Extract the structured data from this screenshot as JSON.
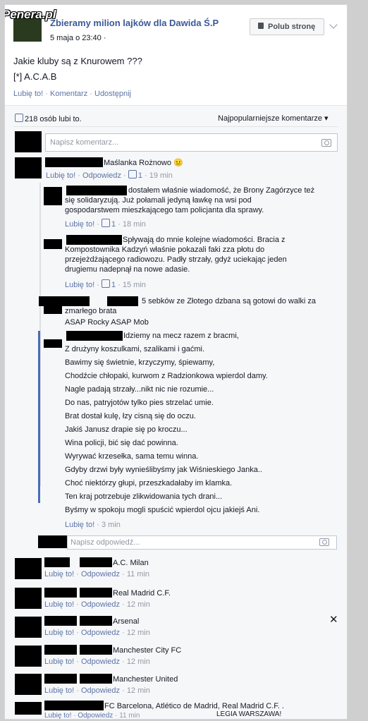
{
  "watermark": "Penera.pl",
  "post": {
    "page_name": "Zbieramy milion lajków dla Dawida Ś.P",
    "timestamp": "5 maja o 23:40 ·",
    "like_page_label": "Polub stronę",
    "body_line1": "Jakie kluby są z Knurowem ???",
    "body_line2": "[*] A.C.A.B",
    "actions": {
      "like": "Lubię to!",
      "comment": "Komentarz",
      "share": "Udostępnij"
    }
  },
  "stats": {
    "likes_text": "218 osób lubi to.",
    "sort_label": "Najpopularniejsze komentarze"
  },
  "comment_input_placeholder": "Napisz komentarz...",
  "reply_input_placeholder": "Napisz odpowiedź...",
  "comments": {
    "c1": {
      "text": "Maślanka Rożnowo 😐",
      "like": "Lubię to!",
      "reply": "Odpowiedz",
      "like_count": "1",
      "time": "19 min"
    },
    "r1": {
      "lines": [
        "dostałem właśnie wiadomość, że Brony Zagórzyce też",
        "się solidaryzują. Już połamali jedyną ławkę na wsi pod",
        "gospodarstwem mieszkającego tam policjanta dla sprawy."
      ],
      "like": "Lubię to!",
      "like_count": "1",
      "time": "18 min"
    },
    "r2": {
      "lines": [
        "Spływają do mnie kolejne wiadomości. Bracia z",
        "Kompostownika Kadzyń właśnie pokazali faki zza płotu do",
        "przejeżdżającego radiowozu. Padły strzały, gdyż uciekając jeden",
        "drugiemu nadepnął na nowe adasie."
      ],
      "like": "Lubię to!",
      "like_count": "1",
      "time": "15 min"
    },
    "r3": {
      "lines": [
        "5 sebków ze Złotego dzbana są gotowi do walki za",
        "zmarłego brata"
      ],
      "link": "ASAP Rocky ASAP Mob"
    },
    "r4": {
      "lines": [
        "Idziemy na mecz razem z bracmi,",
        "Z drużyny koszulkami, szalikami i gaćmi.",
        "Bawimy się świetnie, krzyczymy, śpiewamy,",
        "Chodźcie chłopaki, kurwom z Radzionkowa wpierdol damy.",
        "Nagle padają strzały...nikt nic nie rozumie...",
        "Do nas, patryjotów tylko pies strzelać umie.",
        "Brat dostał kulę, łzy cisną się do oczu.",
        "Jakiś Janusz drapie się po kroczu...",
        "Wina policji, bić się dać powinna.",
        "Wyrywać krzesełka, sama temu winna.",
        "Gdyby drzwi były wynieślibyśmy jak Wiśnieskiego Janka..",
        "Choć niektórzy głupi, przeszkadałaby im klamka.",
        "Ten kraj potrzebuje zlikwidowania tych drani...",
        "Byśmy w spokoju mogli spuścić wpierdol ojcu jakiejś Ani."
      ],
      "like": "Lubię to!",
      "time": "3 min"
    },
    "c2": {
      "text": "A.C. Milan",
      "like": "Lubię to!",
      "reply": "Odpowiedz",
      "time": "11 min"
    },
    "c3": {
      "text": "Real Madrid C.F.",
      "like": "Lubię to!",
      "reply": "Odpowiedz",
      "time": "12 min"
    },
    "c4": {
      "text": "Arsenal",
      "like": "Lubię to!",
      "reply": "Odpowiedz",
      "time": "12 min"
    },
    "c5": {
      "text": "Manchester City FC",
      "like": "Lubię to!",
      "reply": "Odpowiedz",
      "time": "12 min"
    },
    "c6": {
      "text": "Manchester United",
      "like": "Lubię to!",
      "reply": "Odpowiedz",
      "time": "12 min"
    },
    "c7": {
      "text": "FC Barcelona, Atlético de Madrid, Real Madrid C.F. .",
      "like": "Lubię to!",
      "reply": "Odpowiedz",
      "time": "11 min"
    },
    "c8": {
      "text": "LEGIA WARSZAWA!"
    }
  },
  "colors": {
    "link": "#5d74a6",
    "muted": "#9197a3",
    "border": "#d3d6db",
    "accent": "#4a6bb5"
  }
}
